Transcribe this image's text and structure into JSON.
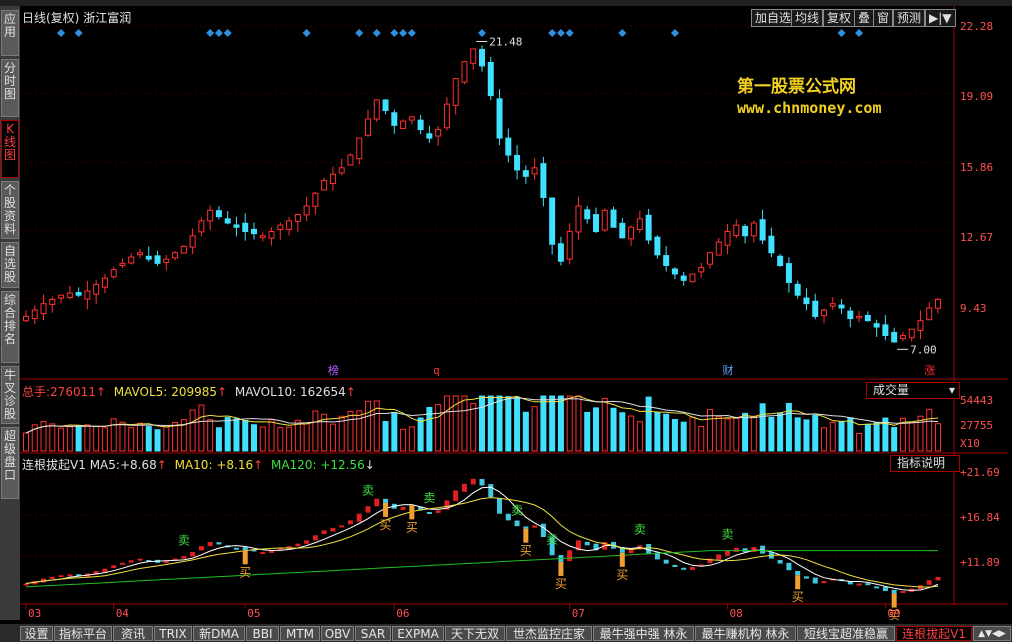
{
  "top_menu_hint": "",
  "sidebar": {
    "tabs": [
      {
        "label": "应用",
        "active": false
      },
      {
        "label": "分时图",
        "active": false
      },
      {
        "label": "K线图",
        "active": true
      },
      {
        "label": "个股资料",
        "active": false
      },
      {
        "label": "自选股",
        "active": false
      },
      {
        "label": "综合排名",
        "active": false
      },
      {
        "label": "牛叉诊股",
        "active": false
      },
      {
        "label": "超级盘口",
        "active": false
      }
    ]
  },
  "header": {
    "title": "日线(复权)",
    "stock_name": "浙江富润",
    "buttons": [
      "加自选",
      "均线",
      "复权",
      "叠",
      "窗",
      "预测",
      "▶|▼"
    ]
  },
  "watermark": {
    "line1": "第一股票公式网",
    "line2": "www.chnmoney.com"
  },
  "price_panel": {
    "y_ticks": [
      "22.28",
      "19.09",
      "15.86",
      "12.67",
      "9.43"
    ],
    "high_label": "21.48",
    "low_label": "7.00",
    "event_labels": [
      {
        "text": "榜",
        "color": "#b060ff"
      },
      {
        "text": "q",
        "color": "#ff3030"
      },
      {
        "text": "财",
        "color": "#60a0ff"
      },
      {
        "text": "涨",
        "color": "#ff3030"
      }
    ],
    "colors": {
      "up": "#ff3030",
      "down": "#40e0ff",
      "diamond": "#3090e0",
      "axis": "#a00000"
    }
  },
  "volume_panel": {
    "total_label": "总手:",
    "total_value": "276011",
    "ma5_label": "MAVOL5:",
    "ma5_value": "209985",
    "ma10_label": "MAVOL10:",
    "ma10_value": "162654",
    "y_ticks": [
      "54443",
      "27755",
      "X10"
    ],
    "dropdown": "成交量"
  },
  "indicator_panel": {
    "name": "连根拔起V1",
    "ma5_label": "MA5:",
    "ma5_value": "+8.68",
    "ma10_label": "MA10:",
    "ma10_value": "+8.16",
    "ma120_label": "MA120:",
    "ma120_value": "+12.56",
    "y_ticks": [
      "+21.69",
      "+16.84",
      "+11.89"
    ],
    "help_button": "指标说明",
    "buy_label": "买",
    "sell_label": "卖"
  },
  "x_axis": {
    "months": [
      "03",
      "04",
      "05",
      "06",
      "07",
      "08",
      "09"
    ]
  },
  "bottom_tabs": [
    {
      "label": "设置",
      "active": false
    },
    {
      "label": "指标平台",
      "active": false
    },
    {
      "label": "资讯",
      "active": false
    },
    {
      "label": "TRIX",
      "active": false
    },
    {
      "label": "新DMA",
      "active": false
    },
    {
      "label": "BBI",
      "active": false
    },
    {
      "label": "MTM",
      "active": false
    },
    {
      "label": "OBV",
      "active": false
    },
    {
      "label": "SAR",
      "active": false
    },
    {
      "label": "EXPMA",
      "active": false
    },
    {
      "label": "天下无双",
      "active": false
    },
    {
      "label": "世杰监控庄家",
      "active": false
    },
    {
      "label": "最牛强中强 林永",
      "active": false
    },
    {
      "label": "最牛赚机构 林永",
      "active": false
    },
    {
      "label": "短线宝超准稳赢",
      "active": false
    },
    {
      "label": "连根拔起V1",
      "active": true
    },
    {
      "label": "▲▼◀▶",
      "active": false
    }
  ],
  "chart_data": {
    "type": "candlestick",
    "series": [
      {
        "name": "price",
        "values": [
          8.6,
          8.9,
          9.2,
          9.4,
          9.6,
          9.7,
          9.6,
          9.8,
          10.1,
          10.4,
          10.8,
          11.1,
          11.4,
          11.6,
          11.3,
          11.1,
          11.3,
          11.6,
          11.9,
          12.4,
          13.1,
          13.6,
          13.3,
          13.0,
          12.8,
          12.6,
          12.5,
          12.4,
          12.6,
          12.9,
          13.1,
          13.4,
          13.8,
          14.4,
          15.0,
          15.3,
          15.6,
          16.2,
          17.0,
          17.9,
          18.8,
          18.3,
          17.6,
          17.8,
          18.0,
          17.4,
          17.0,
          17.4,
          18.6,
          19.8,
          20.6,
          21.2,
          20.4,
          19.0,
          17.0,
          16.2,
          15.5,
          15.2,
          15.6,
          14.2,
          12.0,
          11.2,
          12.6,
          13.8,
          13.2,
          12.6,
          13.6,
          12.8,
          12.3,
          12.8,
          13.2,
          12.2,
          11.5,
          11.0,
          10.6,
          10.3,
          10.6,
          10.9,
          11.6,
          12.1,
          12.6,
          12.9,
          12.4,
          13.0,
          12.2,
          11.6,
          11.0,
          10.2,
          9.6,
          9.2,
          8.6,
          8.9,
          9.2,
          9.0,
          8.5,
          8.6,
          8.4,
          8.1,
          7.7,
          7.4,
          7.7,
          8.0,
          8.4,
          9.0,
          9.4
        ]
      }
    ],
    "ylim": [
      6.5,
      22.28
    ],
    "x_months": [
      "03",
      "04",
      "05",
      "06",
      "07",
      "08",
      "09"
    ],
    "volume_ylim": [
      0,
      54443
    ],
    "indicator": {
      "ma120_start": 8.2,
      "ma120_end": 12.56,
      "ylim": [
        6.5,
        22.5
      ]
    }
  }
}
